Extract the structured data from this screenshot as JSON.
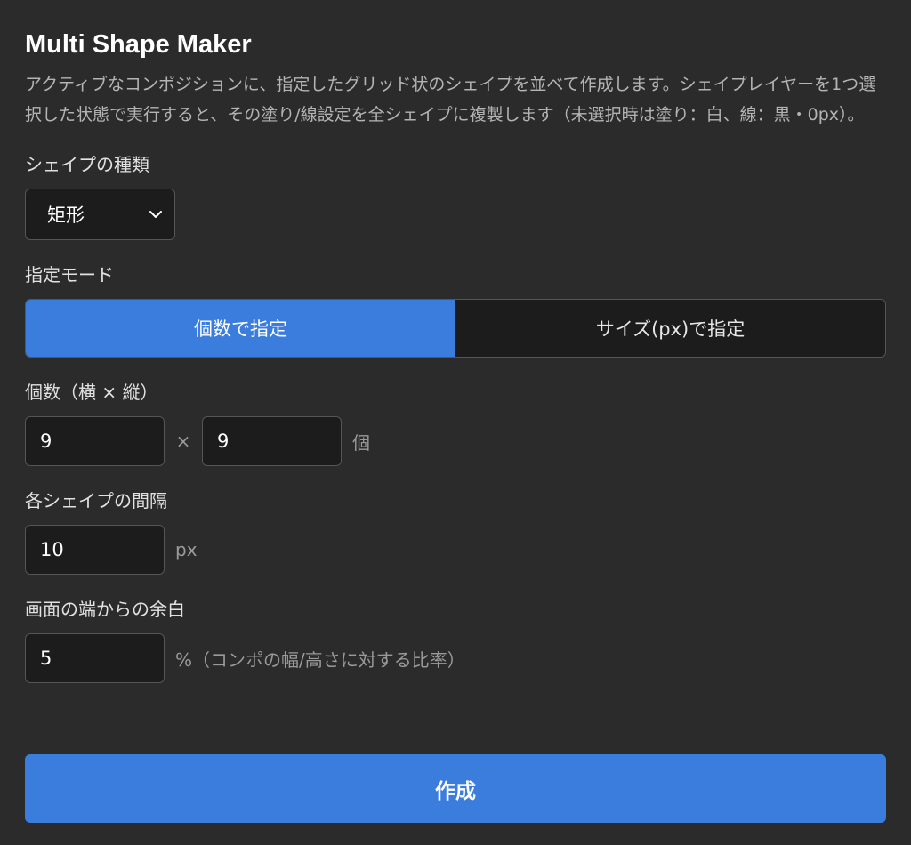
{
  "title": "Multi Shape Maker",
  "description": "アクティブなコンポジションに、指定したグリッド状のシェイプを並べて作成します。シェイプレイヤーを1つ選択した状態で実行すると、その塗り/線設定を全シェイプに複製します（未選択時は塗り：白、線：黒・0px）。",
  "shape_type": {
    "label": "シェイプの種類",
    "selected": "矩形"
  },
  "mode": {
    "label": "指定モード",
    "options": [
      "個数で指定",
      "サイズ(px)で指定"
    ],
    "active": "個数で指定"
  },
  "count": {
    "label": "個数（横 × 縦）",
    "x": "9",
    "times": "×",
    "y": "9",
    "unit": "個"
  },
  "gap": {
    "label": "各シェイプの間隔",
    "value": "10",
    "unit": "px"
  },
  "margin": {
    "label": "画面の端からの余白",
    "value": "5",
    "unit": "%（コンポの幅/高さに対する比率）"
  },
  "create_label": "作成",
  "colors": {
    "background": "#2b2b2c",
    "accent": "#3b7ddd",
    "field": "#1c1c1c"
  },
  "icons": {
    "dropdown": "chevron-down-icon"
  }
}
